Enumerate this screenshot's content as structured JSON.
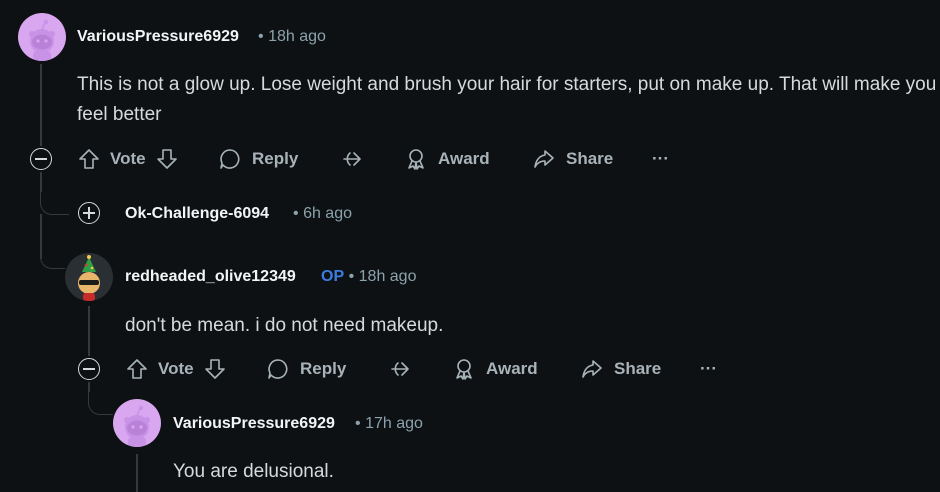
{
  "comments": [
    {
      "username": "VariousPressure6929",
      "time": "18h ago",
      "body": "This is not a glow up. Lose weight and brush your hair for starters, put on make up. That will make you feel better"
    },
    {
      "username": "Ok-Challenge-6094",
      "time": "6h ago",
      "collapsed": true
    },
    {
      "username": "redheaded_olive12349",
      "badge": "OP",
      "time": "18h ago",
      "body": "don't be mean. i do not need makeup."
    },
    {
      "username": "VariousPressure6929",
      "time": "17h ago",
      "body": "You are delusional."
    }
  ],
  "actions": {
    "vote": "Vote",
    "reply": "Reply",
    "award": "Award",
    "share": "Share",
    "more": "···"
  },
  "separator": "•",
  "colors": {
    "background": "#0e1113",
    "avatar_pink": "#d8a7ef",
    "op_badge": "#3a7ce0",
    "thread_line": "#33393c"
  },
  "icons": [
    "upvote-icon",
    "downvote-icon",
    "reply-icon",
    "crosspost-icon",
    "award-icon",
    "share-icon",
    "more-icon",
    "collapse-icon",
    "expand-icon"
  ]
}
